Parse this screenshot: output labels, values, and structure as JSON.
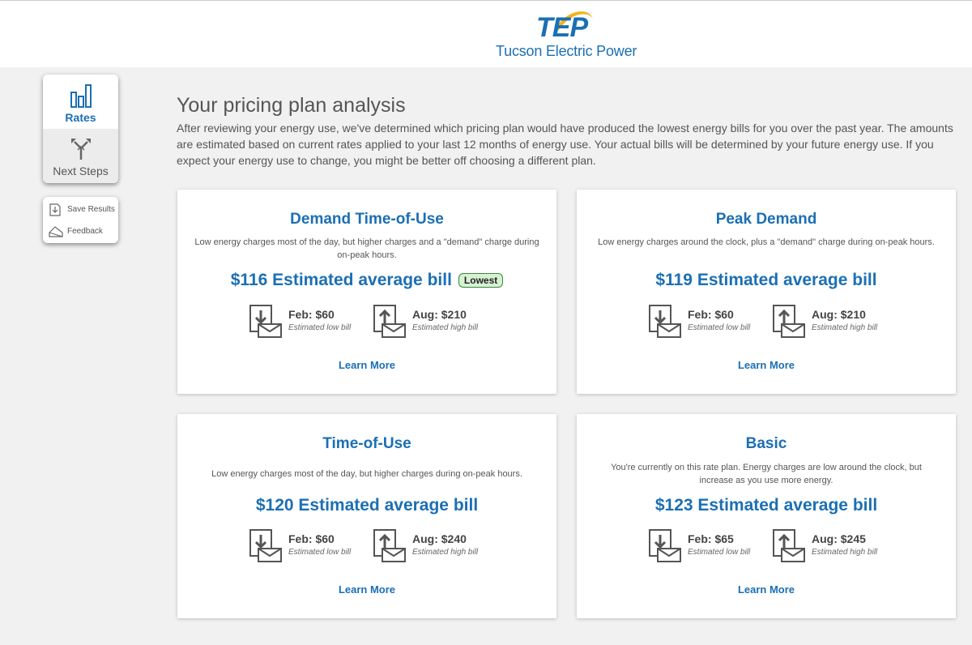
{
  "header": {
    "logo_mark": "TEP",
    "logo_text": "Tucson Electric Power"
  },
  "sidebar": {
    "nav": [
      {
        "label": "Rates",
        "icon": "bar-chart-icon",
        "active": true
      },
      {
        "label": "Next Steps",
        "icon": "directions-icon",
        "active": false
      }
    ],
    "tools": [
      {
        "label": "Save Results",
        "icon": "download-icon"
      },
      {
        "label": "Feedback",
        "icon": "feedback-icon"
      }
    ]
  },
  "main": {
    "title": "Your pricing plan analysis",
    "intro": "After reviewing your energy use, we've determined which pricing plan would have produced the lowest energy bills for you over the past year. The amounts are estimated based on current rates applied to your last 12 months of energy use. Your actual bills will be determined by your future energy use. If you expect your energy use to change, you might be better off choosing a different plan.",
    "plans": [
      {
        "name": "Demand Time-of-Use",
        "description": "Low energy charges most of the day, but higher charges and a \"demand\" charge during on-peak hours.",
        "bill": "$116 Estimated average bill",
        "badge": "Lowest",
        "low_month": "Feb: $60",
        "low_caption": "Estimated low bill",
        "high_month": "Aug: $210",
        "high_caption": "Estimated high bill",
        "link": "Learn More"
      },
      {
        "name": "Peak Demand",
        "description": "Low energy charges around the clock, plus a \"demand\" charge during on-peak hours.",
        "bill": "$119 Estimated average bill",
        "low_month": "Feb: $60",
        "low_caption": "Estimated low bill",
        "high_month": "Aug: $210",
        "high_caption": "Estimated high bill",
        "link": "Learn More"
      },
      {
        "name": "Time-of-Use",
        "description": "Low energy charges most of the day, but higher charges during on-peak hours.",
        "bill": "$120 Estimated average bill",
        "low_month": "Feb: $60",
        "low_caption": "Estimated low bill",
        "high_month": "Aug: $240",
        "high_caption": "Estimated high bill",
        "link": "Learn More"
      },
      {
        "name": "Basic",
        "description": "You're currently on this rate plan. Energy charges are low around the clock, but increase as you use more energy.",
        "bill": "$123 Estimated average bill",
        "low_month": "Feb: $65",
        "low_caption": "Estimated low bill",
        "high_month": "Aug: $245",
        "high_caption": "Estimated high bill",
        "link": "Learn More"
      }
    ]
  },
  "colors": {
    "brand_blue": "#1b6fb4",
    "logo_gold": "#f2b41c",
    "badge_green": "#d6f2d3"
  }
}
